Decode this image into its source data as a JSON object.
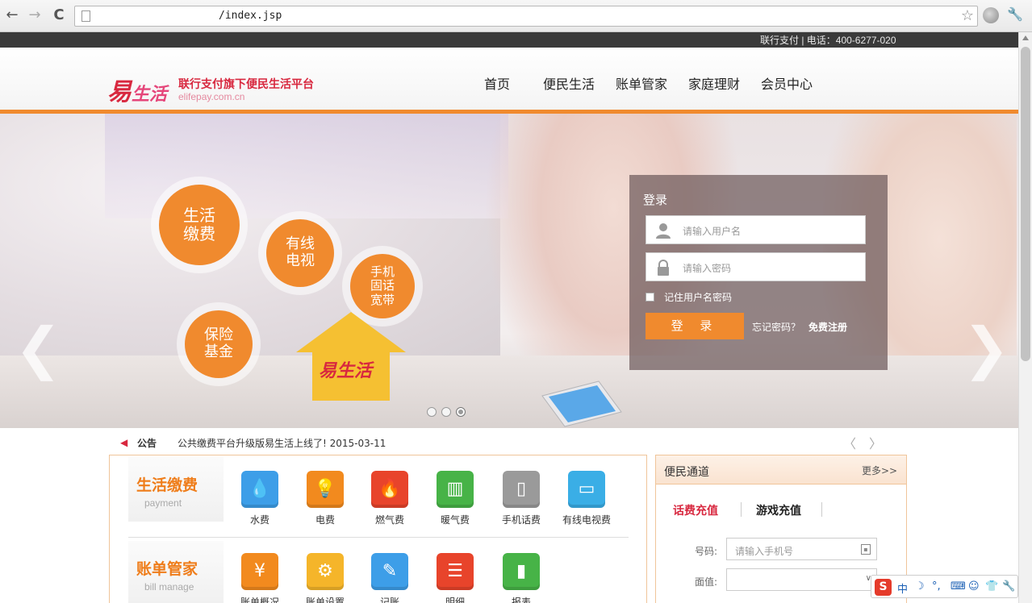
{
  "browser": {
    "back_glyph": "←",
    "forward_glyph": "→",
    "reload_glyph": "C",
    "url": "/index.jsp",
    "star_glyph": "☆",
    "wrench_glyph": "🔧"
  },
  "topbar": {
    "text": "联行支付 | 电话：400-6277-020"
  },
  "header": {
    "logo_main": "易",
    "logo_rest": "生活",
    "slogan": "联行支付旗下便民生活平台",
    "domain": "elifepay.com.cn",
    "nav": [
      {
        "label": "首页"
      },
      {
        "label": "便民生活"
      },
      {
        "label": "账单管家"
      },
      {
        "label": "家庭理财"
      },
      {
        "label": "会员中心"
      }
    ]
  },
  "banner": {
    "circles": [
      {
        "line1": "生活",
        "line2": "缴费",
        "line3": ""
      },
      {
        "line1": "有线",
        "line2": "电视",
        "line3": ""
      },
      {
        "line1": "手机",
        "line2": "固话",
        "line3": "宽带"
      },
      {
        "line1": "保险",
        "line2": "基金",
        "line3": ""
      }
    ],
    "house_logo": "易生活",
    "prev_glyph": "❮",
    "next_glyph": "❯",
    "active_slide": 3,
    "slide_count": 3
  },
  "login": {
    "title": "登录",
    "username_placeholder": "请输入用户名",
    "password_placeholder": "请输入密码",
    "remember_label": "记住用户名密码",
    "button_label": "登 录",
    "forgot_label": "忘记密码？",
    "register_label": "免费注册",
    "user_icon": "user-icon",
    "lock_icon": "lock-icon"
  },
  "notice": {
    "label": "公告",
    "text": "公共缴费平台升级版易生活上线了!  2015-03-11",
    "prev_glyph": "〈",
    "next_glyph": "〉"
  },
  "services": {
    "sections": [
      {
        "title": "生活缴费",
        "subtitle": "payment",
        "items": [
          {
            "label": "水费",
            "glyph": "💧",
            "color": "#3d9ee8"
          },
          {
            "label": "电费",
            "glyph": "💡",
            "color": "#f28a1e"
          },
          {
            "label": "燃气费",
            "glyph": "🔥",
            "color": "#e8442b"
          },
          {
            "label": "暖气费",
            "glyph": "▥",
            "color": "#47b347"
          },
          {
            "label": "手机话费",
            "glyph": "▯",
            "color": "#9a9a9a"
          },
          {
            "label": "有线电视费",
            "glyph": "▭",
            "color": "#3aaee6"
          }
        ]
      },
      {
        "title": "账单管家",
        "subtitle": "bill manage",
        "items": [
          {
            "label": "账单概况",
            "glyph": "¥",
            "color": "#f28a1e"
          },
          {
            "label": "账单设置",
            "glyph": "⚙",
            "color": "#f5b52a"
          },
          {
            "label": "记账",
            "glyph": "✎",
            "color": "#3d9ee8"
          },
          {
            "label": "明细",
            "glyph": "☰",
            "color": "#e8442b"
          },
          {
            "label": "报表",
            "glyph": "▮",
            "color": "#47b347"
          }
        ]
      }
    ]
  },
  "channel": {
    "title": "便民通道",
    "more": "更多>>",
    "tabs": [
      {
        "label": "话费充值",
        "active": true
      },
      {
        "label": "游戏充值",
        "active": false
      }
    ],
    "number_label": "号码:",
    "number_placeholder": "请输入手机号",
    "amount_label": "面值:",
    "amount_value": ""
  },
  "ime": {
    "logo": "S",
    "items": [
      "中",
      "☽",
      "°,",
      "⌨",
      "☺",
      "👕",
      "🔧"
    ]
  },
  "colors": {
    "accent": "#f08a2e",
    "brand_red": "#d8283f",
    "border_orange": "#f0c59a"
  }
}
